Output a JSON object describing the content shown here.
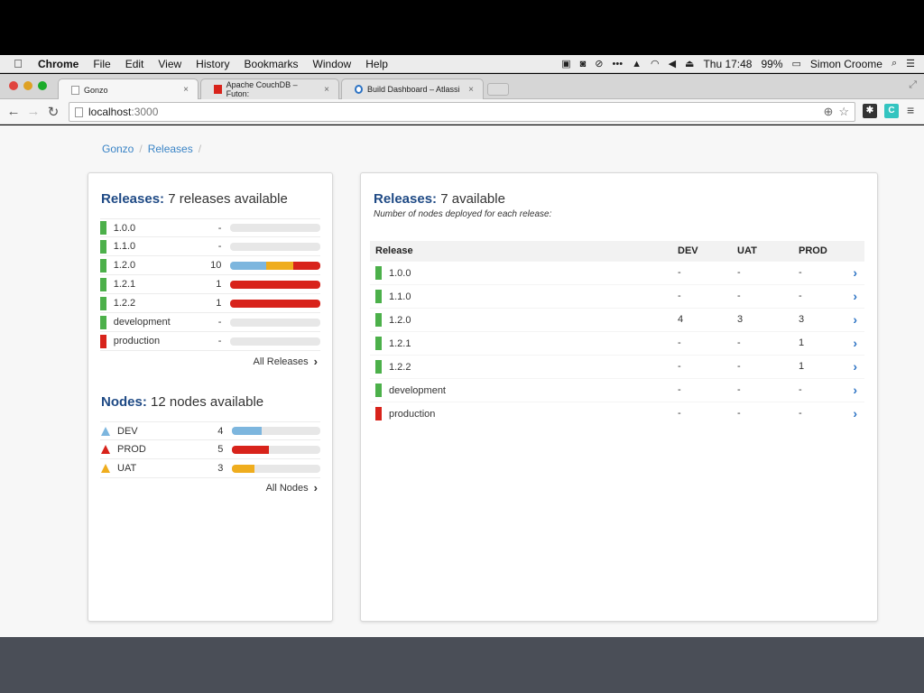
{
  "menubar": {
    "apple": "",
    "items": [
      "Chrome",
      "File",
      "Edit",
      "View",
      "History",
      "Bookmarks",
      "Window",
      "Help"
    ],
    "clock": "Thu 17:48",
    "battery": "99%",
    "user": "Simon Croome"
  },
  "tabs": [
    {
      "label": "Gonzo",
      "close": "×"
    },
    {
      "label": "Apache CouchDB – Futon:",
      "close": "×"
    },
    {
      "label": "Build Dashboard – Atlassi",
      "close": "×"
    }
  ],
  "toolbar": {
    "url_host": "localhost",
    "url_port": ":3000"
  },
  "breadcrumb": {
    "home": "Gonzo",
    "sep": "/",
    "current": "Releases"
  },
  "left": {
    "releases_title": "Releases:",
    "releases_subtitle": "7 releases available",
    "releases": [
      {
        "name": "1.0.0",
        "count": "-",
        "color": "#4cb04a",
        "segments": []
      },
      {
        "name": "1.1.0",
        "count": "-",
        "color": "#4cb04a",
        "segments": []
      },
      {
        "name": "1.2.0",
        "count": "10",
        "color": "#4cb04a",
        "segments": [
          {
            "color": "#7db6de",
            "frac": 0.4
          },
          {
            "color": "#efad1e",
            "frac": 0.3
          },
          {
            "color": "#d8231b",
            "frac": 0.3
          }
        ]
      },
      {
        "name": "1.2.1",
        "count": "1",
        "color": "#4cb04a",
        "segments": [
          {
            "color": "#d8231b",
            "frac": 1.0
          }
        ]
      },
      {
        "name": "1.2.2",
        "count": "1",
        "color": "#4cb04a",
        "segments": [
          {
            "color": "#d8231b",
            "frac": 1.0
          }
        ]
      },
      {
        "name": "development",
        "count": "-",
        "color": "#4cb04a",
        "segments": []
      },
      {
        "name": "production",
        "count": "-",
        "color": "#d8231b",
        "segments": []
      }
    ],
    "all_releases": "All Releases",
    "nodes_title": "Nodes:",
    "nodes_subtitle": "12 nodes available",
    "nodes": [
      {
        "name": "DEV",
        "count": "4",
        "color": "#7db6de",
        "frac": 0.333
      },
      {
        "name": "PROD",
        "count": "5",
        "color": "#d8231b",
        "frac": 0.417
      },
      {
        "name": "UAT",
        "count": "3",
        "color": "#efad1e",
        "frac": 0.25
      }
    ],
    "all_nodes": "All Nodes"
  },
  "right": {
    "title": "Releases:",
    "subtitle": "7 available",
    "description": "Number of nodes deployed for each release:",
    "columns": [
      "Release",
      "DEV",
      "UAT",
      "PROD"
    ],
    "rows": [
      {
        "name": "1.0.0",
        "color": "#4cb04a",
        "dev": "-",
        "uat": "-",
        "prod": "-"
      },
      {
        "name": "1.1.0",
        "color": "#4cb04a",
        "dev": "-",
        "uat": "-",
        "prod": "-"
      },
      {
        "name": "1.2.0",
        "color": "#4cb04a",
        "dev": "4",
        "uat": "3",
        "prod": "3"
      },
      {
        "name": "1.2.1",
        "color": "#4cb04a",
        "dev": "-",
        "uat": "-",
        "prod": "1"
      },
      {
        "name": "1.2.2",
        "color": "#4cb04a",
        "dev": "-",
        "uat": "-",
        "prod": "1"
      },
      {
        "name": "development",
        "color": "#4cb04a",
        "dev": "-",
        "uat": "-",
        "prod": "-"
      },
      {
        "name": "production",
        "color": "#d8231b",
        "dev": "-",
        "uat": "-",
        "prod": "-"
      }
    ]
  }
}
